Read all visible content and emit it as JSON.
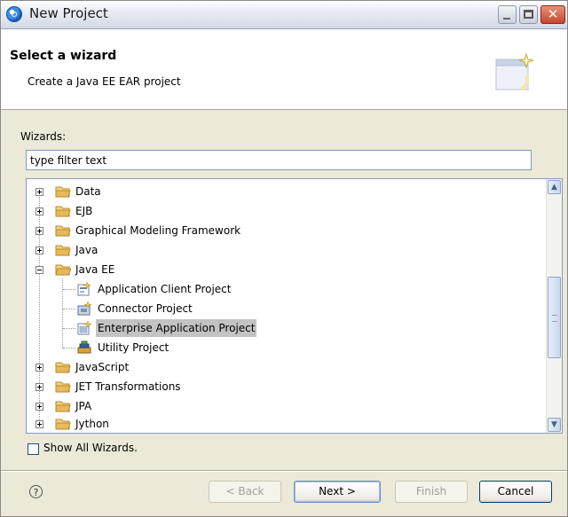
{
  "window": {
    "title": "New Project"
  },
  "header": {
    "title": "Select a wizard",
    "description": "Create a Java EE EAR project"
  },
  "wizards_label": "Wizards:",
  "filter": {
    "value": "type filter text"
  },
  "tree": {
    "items": [
      {
        "label": "Data",
        "expanded": false,
        "level": 0,
        "icon": "folder-icon"
      },
      {
        "label": "EJB",
        "expanded": false,
        "level": 0,
        "icon": "folder-icon"
      },
      {
        "label": "Graphical Modeling Framework",
        "expanded": false,
        "level": 0,
        "icon": "folder-icon"
      },
      {
        "label": "Java",
        "expanded": false,
        "level": 0,
        "icon": "folder-icon"
      },
      {
        "label": "Java EE",
        "expanded": true,
        "level": 0,
        "icon": "folder-icon"
      },
      {
        "label": "Application Client Project",
        "level": 1,
        "icon": "app-client-project-icon"
      },
      {
        "label": "Connector Project",
        "level": 1,
        "icon": "connector-project-icon"
      },
      {
        "label": "Enterprise Application Project",
        "level": 1,
        "icon": "ear-project-icon",
        "selected": true
      },
      {
        "label": "Utility Project",
        "level": 1,
        "icon": "utility-project-icon"
      },
      {
        "label": "JavaScript",
        "expanded": false,
        "level": 0,
        "icon": "folder-icon"
      },
      {
        "label": "JET Transformations",
        "expanded": false,
        "level": 0,
        "icon": "folder-icon"
      },
      {
        "label": "JPA",
        "expanded": false,
        "level": 0,
        "icon": "folder-icon"
      },
      {
        "label": "Jython",
        "expanded": false,
        "level": 0,
        "icon": "folder-icon"
      }
    ]
  },
  "show_all": {
    "label": "Show All Wizards.",
    "checked": false
  },
  "buttons": {
    "help": "?",
    "back": "< Back",
    "next": "Next >",
    "finish": "Finish",
    "cancel": "Cancel"
  },
  "colors": {
    "selection": "#c3c3c3",
    "folder": "#e8b95a",
    "frame": "#ece9d8"
  }
}
